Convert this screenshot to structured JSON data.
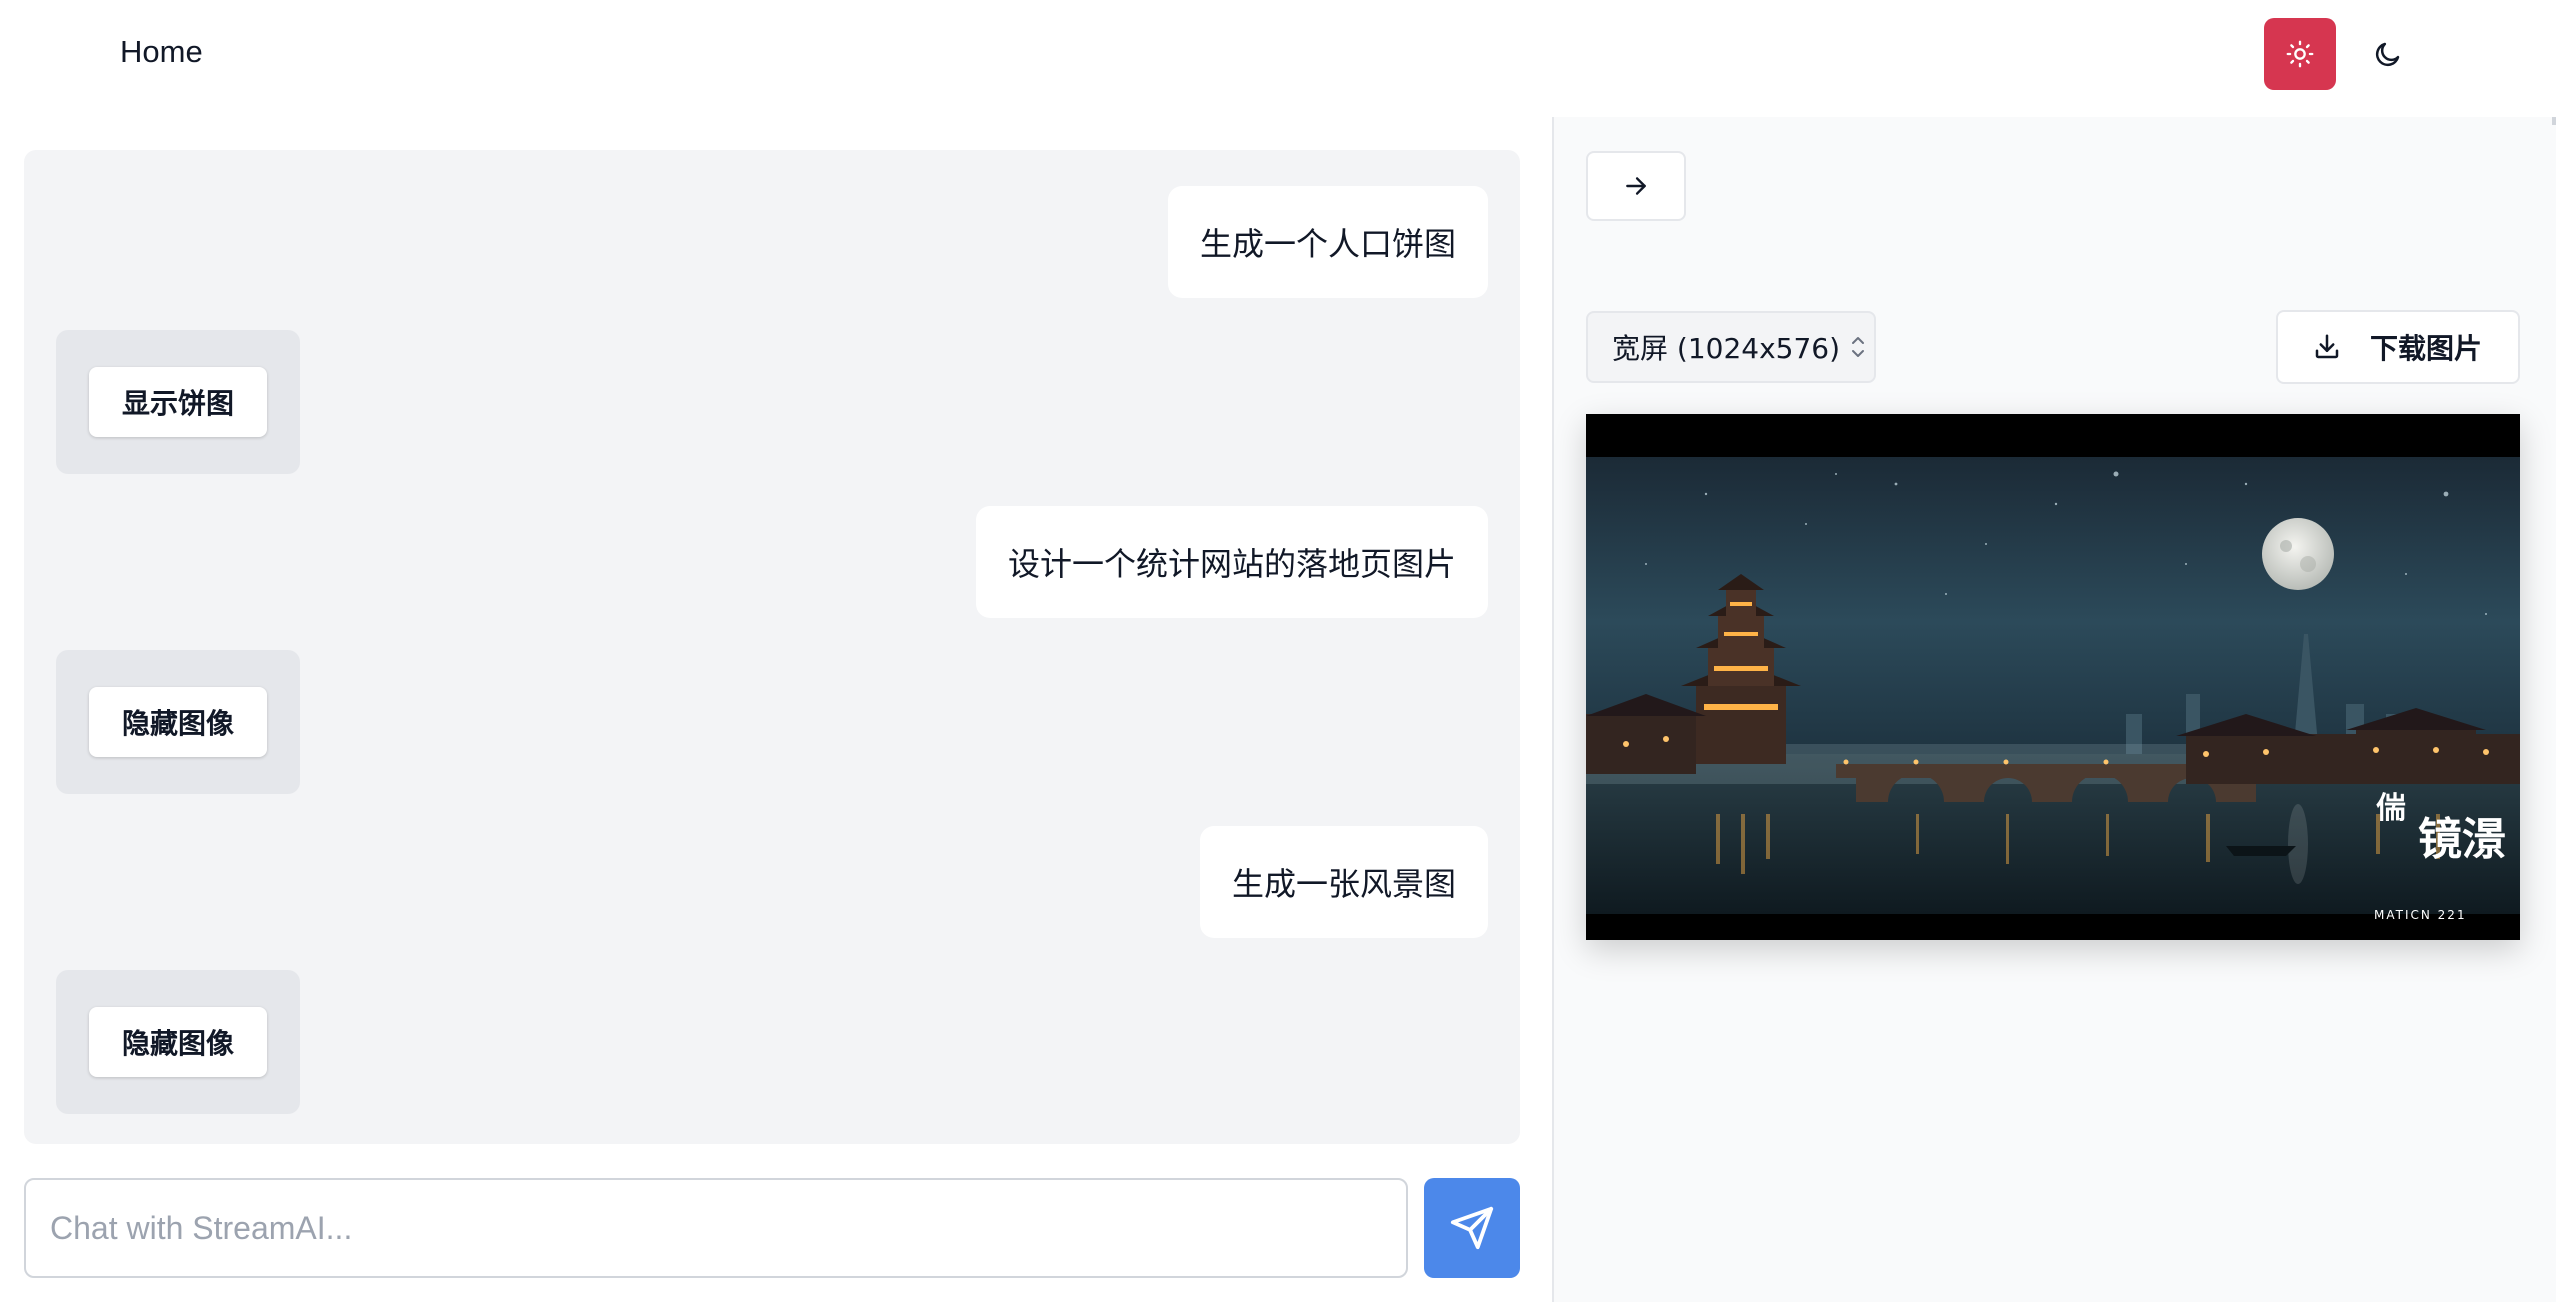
{
  "header": {
    "home_label": "Home",
    "icons": {
      "light_mode": "sun-icon",
      "dark_mode": "moon-icon"
    },
    "accent_color": "#d63650"
  },
  "chat": {
    "messages": [
      {
        "role": "user",
        "text": "生成一个人口饼图"
      },
      {
        "role": "assistant",
        "button_label": "显示饼图"
      },
      {
        "role": "user",
        "text": "设计一个统计网站的落地页图片"
      },
      {
        "role": "assistant",
        "button_label": "隐藏图像"
      },
      {
        "role": "user",
        "text": "生成一张风景图"
      },
      {
        "role": "assistant",
        "button_label": "隐藏图像"
      }
    ],
    "input": {
      "value": "",
      "placeholder": "Chat with StreamAI..."
    },
    "send_icon": "paper-plane-icon",
    "send_color": "#4c88ea"
  },
  "image_panel": {
    "collapse_icon": "arrow-right-icon",
    "size_select": {
      "selected": "宽屏 (1024x576)",
      "icon": "chevron-up-down-icon"
    },
    "download": {
      "label": "下载图片",
      "icon": "download-icon"
    },
    "image": {
      "description_icon": "landscape-image",
      "watermark_title": "镜澋",
      "watermark_subtitle": "MATICN 221"
    }
  }
}
